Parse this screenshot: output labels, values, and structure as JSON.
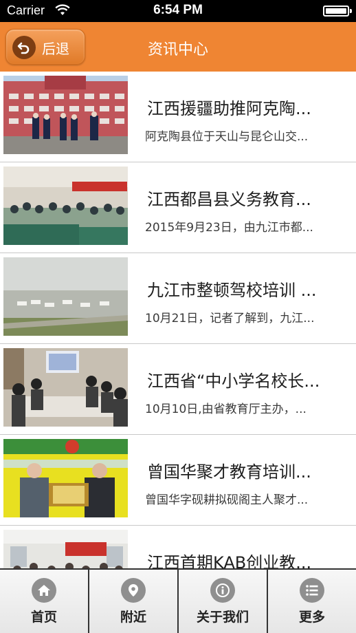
{
  "status_bar": {
    "carrier": "Carrier",
    "time": "6:54 PM"
  },
  "nav": {
    "back_label": "后退",
    "title": "资讯中心"
  },
  "news": [
    {
      "title": "江西援疆助推阿克陶...",
      "summary": "阿克陶县位于天山与昆仑山交...",
      "image": "building-students-photo"
    },
    {
      "title": "江西都昌县义务教育...",
      "summary": "2015年9月23日，由九江市都...",
      "image": "conference-room-photo"
    },
    {
      "title": "九江市整顿驾校培训 ...",
      "summary": "10月21日，记者了解到，九江...",
      "image": "driving-school-lot-photo"
    },
    {
      "title": "江西省“中小学名校长...",
      "summary": "10月10日,由省教育厅主办，...",
      "image": "meeting-table-photo"
    },
    {
      "title": "曾国华聚才教育培训...",
      "summary": "曾国华字砚耕拟砚阁主人聚才...",
      "image": "plaque-ceremony-photo"
    },
    {
      "title": "江西首期KAB创业教...",
      "summary": "",
      "image": "training-hall-photo"
    }
  ],
  "tabs": [
    {
      "label": "首页",
      "icon": "home-icon"
    },
    {
      "label": "附近",
      "icon": "location-pin-icon"
    },
    {
      "label": "关于我们",
      "icon": "info-icon"
    },
    {
      "label": "更多",
      "icon": "list-icon"
    }
  ],
  "colors": {
    "nav_bar": "#ef8533",
    "back_circle": "#7d3d12",
    "tab_icon": "#8f8f8f"
  }
}
